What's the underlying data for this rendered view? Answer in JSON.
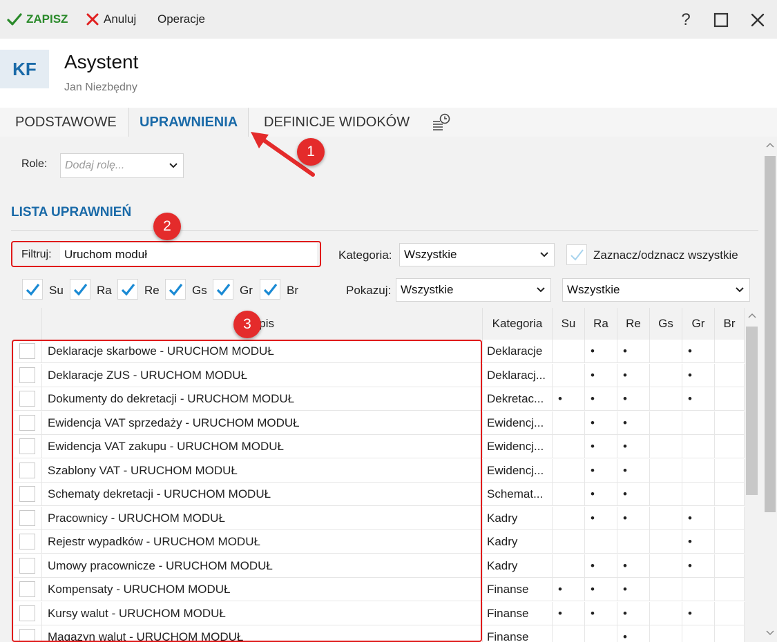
{
  "toolbar": {
    "save_label": "ZAPISZ",
    "cancel_label": "Anuluj",
    "operations_label": "Operacje",
    "help_label": "?"
  },
  "header": {
    "avatar_initials": "KF",
    "title": "Asystent",
    "subtitle": "Jan Niezbędny"
  },
  "tabs": [
    {
      "label": "PODSTAWOWE"
    },
    {
      "label": "UPRAWNIENIA"
    },
    {
      "label": "DEFINICJE WIDOKÓW"
    }
  ],
  "roles": {
    "label": "Role:",
    "placeholder": "Dodaj rolę..."
  },
  "section_title": "LISTA UPRAWNIEŃ",
  "filter": {
    "label": "Filtruj:",
    "value": "Uruchom moduł"
  },
  "category": {
    "label": "Kategoria:",
    "value": "Wszystkie"
  },
  "select_all_label": "Zaznacz/odznacz wszystkie",
  "show": {
    "label": "Pokazuj:",
    "value1": "Wszystkie",
    "value2": "Wszystkie"
  },
  "role_checkboxes": [
    "Su",
    "Ra",
    "Re",
    "Gs",
    "Gr",
    "Br"
  ],
  "grid": {
    "columns": [
      "Opis",
      "Kategoria",
      "Su",
      "Ra",
      "Re",
      "Gs",
      "Gr",
      "Br"
    ],
    "rows": [
      {
        "opis": "Deklaracje skarbowe - URUCHOM MODUŁ",
        "kategoria": "Deklaracje",
        "su": "",
        "ra": "•",
        "re": "•",
        "gs": "",
        "gr": "•",
        "br": ""
      },
      {
        "opis": "Deklaracje ZUS - URUCHOM MODUŁ",
        "kategoria": "Deklaracj...",
        "su": "",
        "ra": "•",
        "re": "•",
        "gs": "",
        "gr": "•",
        "br": ""
      },
      {
        "opis": "Dokumenty do dekretacji - URUCHOM MODUŁ",
        "kategoria": "Dekretac...",
        "su": "•",
        "ra": "•",
        "re": "•",
        "gs": "",
        "gr": "•",
        "br": ""
      },
      {
        "opis": "Ewidencja VAT sprzedaży - URUCHOM MODUŁ",
        "kategoria": "Ewidencj...",
        "su": "",
        "ra": "•",
        "re": "•",
        "gs": "",
        "gr": "",
        "br": ""
      },
      {
        "opis": "Ewidencja VAT zakupu - URUCHOM MODUŁ",
        "kategoria": "Ewidencj...",
        "su": "",
        "ra": "•",
        "re": "•",
        "gs": "",
        "gr": "",
        "br": ""
      },
      {
        "opis": "Szablony VAT - URUCHOM MODUŁ",
        "kategoria": "Ewidencj...",
        "su": "",
        "ra": "•",
        "re": "•",
        "gs": "",
        "gr": "",
        "br": ""
      },
      {
        "opis": "Schematy dekretacji - URUCHOM MODUŁ",
        "kategoria": "Schemat...",
        "su": "",
        "ra": "•",
        "re": "•",
        "gs": "",
        "gr": "",
        "br": ""
      },
      {
        "opis": "Pracownicy - URUCHOM MODUŁ",
        "kategoria": "Kadry",
        "su": "",
        "ra": "•",
        "re": "•",
        "gs": "",
        "gr": "•",
        "br": ""
      },
      {
        "opis": "Rejestr wypadków - URUCHOM MODUŁ",
        "kategoria": "Kadry",
        "su": "",
        "ra": "",
        "re": "",
        "gs": "",
        "gr": "•",
        "br": ""
      },
      {
        "opis": "Umowy pracownicze - URUCHOM MODUŁ",
        "kategoria": "Kadry",
        "su": "",
        "ra": "•",
        "re": "•",
        "gs": "",
        "gr": "•",
        "br": ""
      },
      {
        "opis": "Kompensaty - URUCHOM MODUŁ",
        "kategoria": "Finanse",
        "su": "•",
        "ra": "•",
        "re": "•",
        "gs": "",
        "gr": "",
        "br": ""
      },
      {
        "opis": "Kursy walut - URUCHOM MODUŁ",
        "kategoria": "Finanse",
        "su": "•",
        "ra": "•",
        "re": "•",
        "gs": "",
        "gr": "•",
        "br": ""
      },
      {
        "opis": "Magazyn walut - URUCHOM MODUŁ",
        "kategoria": "Finanse",
        "su": "",
        "ra": "",
        "re": "•",
        "gs": "",
        "gr": "",
        "br": ""
      }
    ]
  },
  "annotations": [
    "1",
    "2",
    "3"
  ],
  "colors": {
    "accent": "#1a6aa8",
    "save_green": "#2a8a2a",
    "annotation_red": "#e01a1a"
  }
}
